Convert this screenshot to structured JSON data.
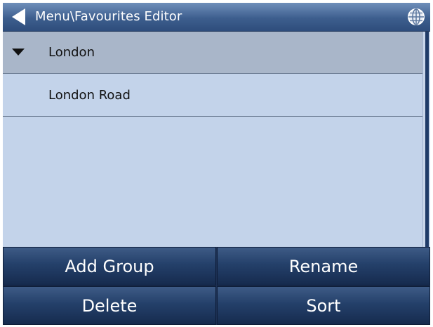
{
  "titlebar": {
    "title": "Menu\\Favourites Editor",
    "back_icon": "back-arrow-icon",
    "globe_icon": "globe-icon"
  },
  "list": {
    "items": [
      {
        "label": "London",
        "expanded": true,
        "selected": true,
        "icon": "expand-arrow-icon"
      },
      {
        "label": "London Road",
        "expanded": false,
        "selected": false
      }
    ]
  },
  "buttons": {
    "add_group": "Add Group",
    "rename": "Rename",
    "delete": "Delete",
    "sort": "Sort"
  },
  "colors": {
    "title_bar": "#3d5e8e",
    "list_background": "#c3d3ea",
    "selected_row": "#a9b6c9",
    "button": "#24406a",
    "scroll_thumb": "#1f3b68"
  }
}
